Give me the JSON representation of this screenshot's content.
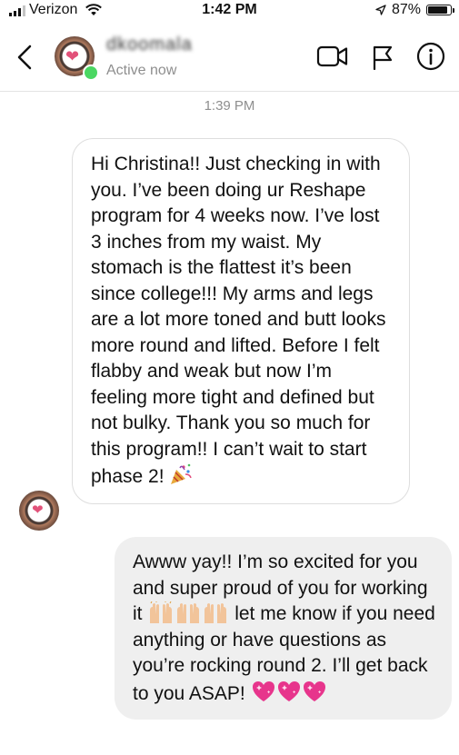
{
  "status_bar": {
    "carrier": "Verizon",
    "time": "1:42 PM",
    "battery": "87%",
    "battery_level": 0.87
  },
  "header": {
    "username": "dkoomala",
    "status": "Active now",
    "icons": [
      "chevron-left-icon",
      "video-camera-icon",
      "flag-icon",
      "info-icon"
    ]
  },
  "chat": {
    "timestamp": "1:39 PM",
    "messages": [
      {
        "direction": "incoming",
        "text": "Hi Christina!!  Just checking in with you.  I’ve been doing ur Reshape program for 4 weeks now.  I’ve lost 3 inches from my waist.  My stomach is the flattest it’s been since college!!!  My arms and legs are a lot more toned and butt looks more round and lifted.  Before I felt flabby and weak but now I’m feeling more tight and defined but not bulky.  Thank you so much for this program!!  I can’t wait to start phase 2!",
        "trailing_emoji": "party-popper-emoji"
      },
      {
        "direction": "outgoing",
        "text_a": "Awww yay!!  I’m so excited for you and super proud of you for working it",
        "mid_emoji": [
          "raising-hands-emoji",
          "raising-hands-emoji",
          "raising-hands-emoji"
        ],
        "text_b": "let me know if you need anything or have questions as you’re rocking round 2.  I’ll get back to you ASAP!",
        "trailing_emoji": [
          "sparkling-heart-emoji",
          "sparkling-heart-emoji",
          "sparkling-heart-emoji"
        ]
      }
    ]
  },
  "colors": {
    "online": "#4bd763",
    "incoming_border": "#dedede",
    "outgoing_bg": "#efefef",
    "muted_text": "#8e8e8e"
  }
}
